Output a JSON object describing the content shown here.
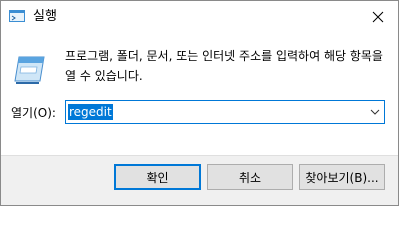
{
  "window": {
    "title": "실행",
    "title_icon": "run-icon",
    "close_icon": "close-icon"
  },
  "dialog": {
    "description": "프로그램, 폴더, 문서, 또는 인터넷 주소를 입력하여 해당 항목을 열 수 있습니다.",
    "icon": "run-dialog-icon",
    "open_label": "열기(O):",
    "open_value": "regedit"
  },
  "buttons": {
    "ok": "확인",
    "cancel": "취소",
    "browse": "찾아보기(B)..."
  },
  "colors": {
    "accent": "#0078d7",
    "footer_bg": "#f0f0f0",
    "button_bg": "#e1e1e1"
  }
}
